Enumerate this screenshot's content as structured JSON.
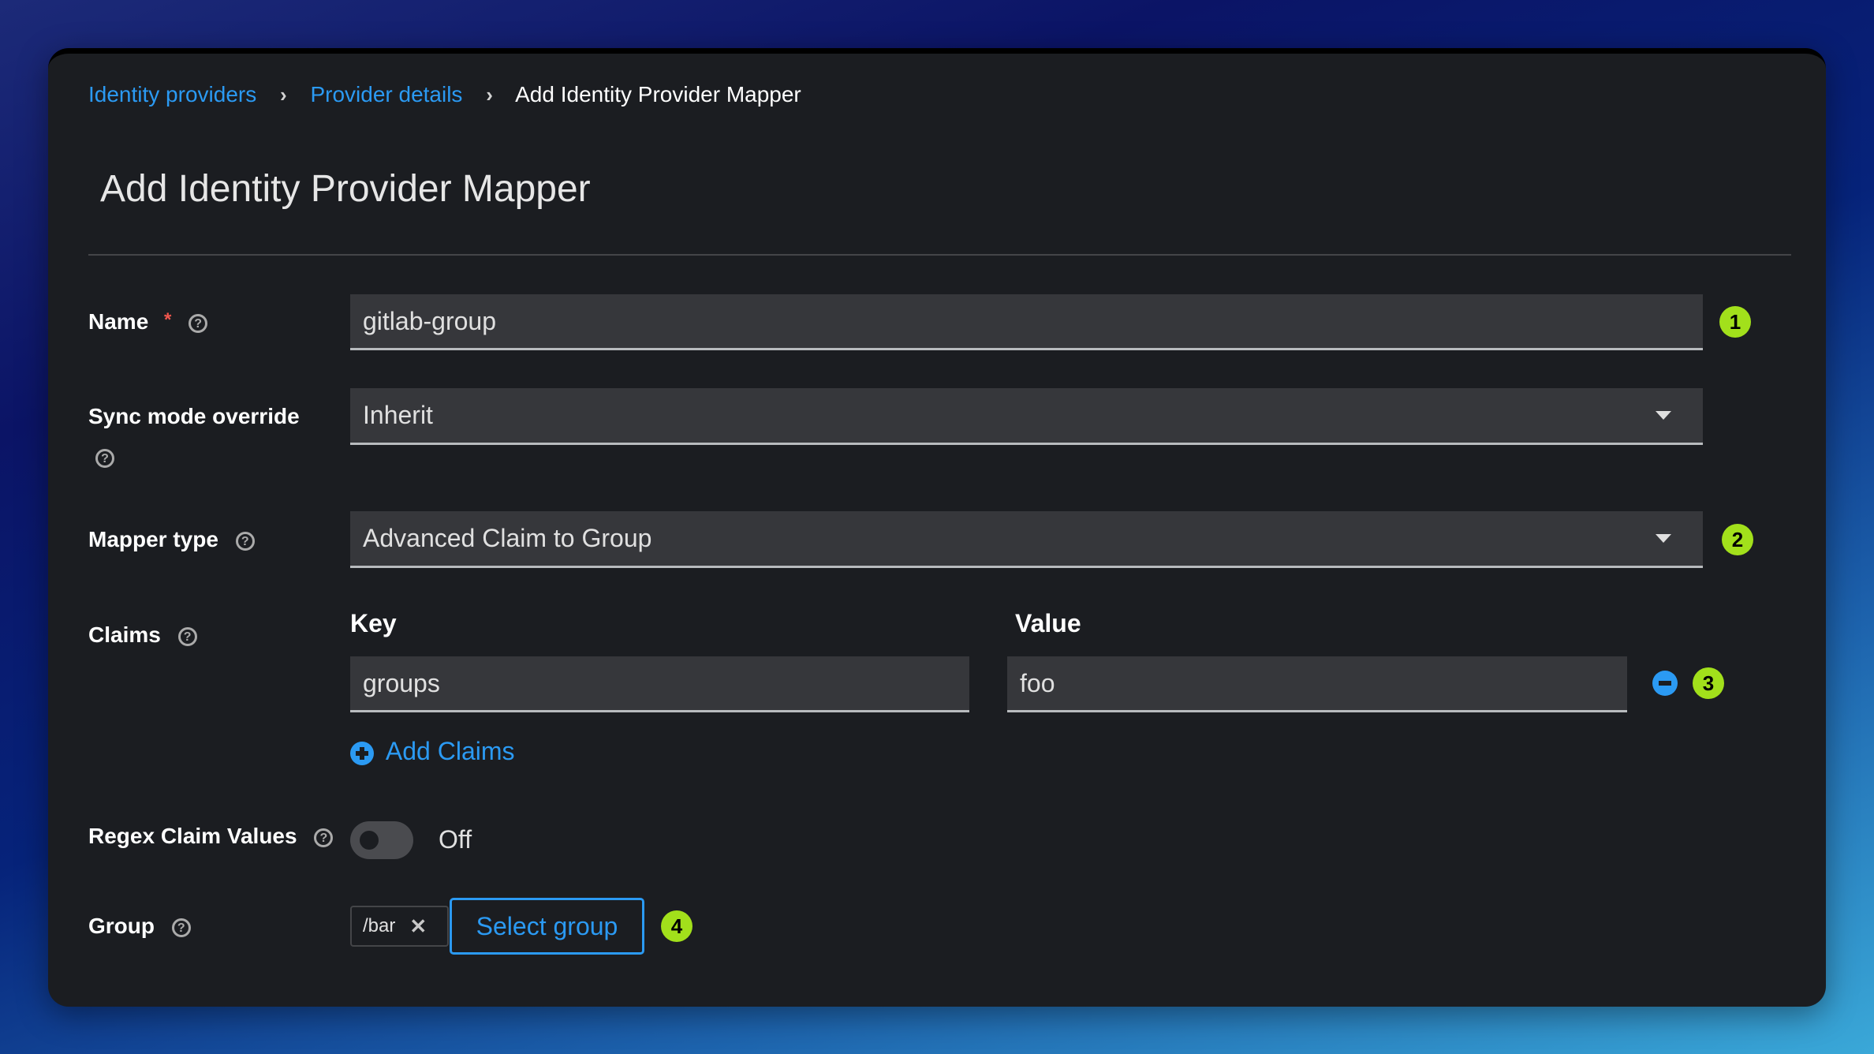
{
  "breadcrumb": {
    "items": [
      {
        "label": "Identity providers",
        "link": true
      },
      {
        "label": "Provider details",
        "link": true
      },
      {
        "label": "Add Identity Provider Mapper",
        "link": false
      }
    ],
    "separator": "›"
  },
  "page_title": "Add Identity Provider Mapper",
  "form": {
    "name": {
      "label": "Name",
      "required_mark": "*",
      "value": "gitlab-group",
      "badge": "1"
    },
    "sync_mode": {
      "label": "Sync mode override",
      "value": "Inherit"
    },
    "mapper_type": {
      "label": "Mapper type",
      "value": "Advanced Claim to Group",
      "badge": "2"
    },
    "claims": {
      "label": "Claims",
      "key_header": "Key",
      "value_header": "Value",
      "rows": [
        {
          "key": "groups",
          "value": "foo"
        }
      ],
      "badge": "3",
      "add_label": "Add Claims"
    },
    "regex": {
      "label": "Regex Claim Values",
      "state": "Off",
      "enabled": false
    },
    "group": {
      "label": "Group",
      "chip": "/bar",
      "chip_remove": "✕",
      "select_label": "Select group",
      "badge": "4"
    }
  },
  "icons": {
    "help": "?"
  },
  "colors": {
    "accent": "#2b9af3",
    "badge": "#a2e01b",
    "required": "#f0564d",
    "background": "#1b1d21"
  }
}
